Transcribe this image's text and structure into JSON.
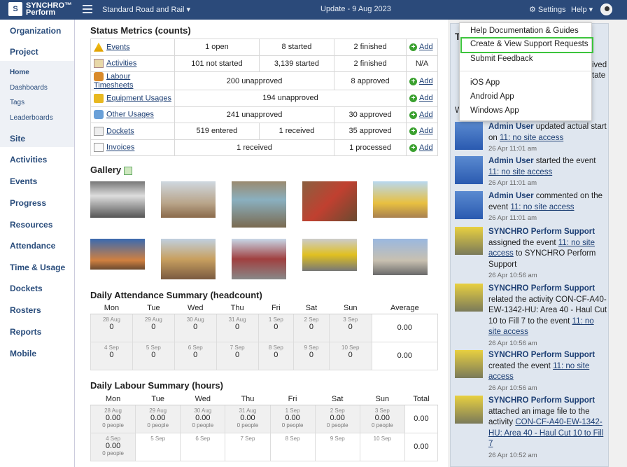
{
  "app": {
    "logo_line1": "SYNCHRO™",
    "logo_line2": "Perform",
    "project": "Standard Road and Rail ▾",
    "update": "Update - 9 Aug 2023",
    "settings": "⚙ Settings",
    "help": "Help ▾"
  },
  "sidebar": {
    "items": [
      "Organization",
      "Project",
      "Site",
      "Activities",
      "Events",
      "Progress",
      "Resources",
      "Attendance",
      "Time & Usage",
      "Dockets",
      "Rosters",
      "Reports",
      "Mobile"
    ],
    "sub": [
      "Home",
      "Dashboards",
      "Tags",
      "Leaderboards"
    ]
  },
  "status": {
    "title": "Status Metrics (counts)",
    "add": "Add",
    "rows": [
      [
        "Events",
        "1 open",
        "8 started",
        "2 finished"
      ],
      [
        "Activities",
        "101 not started",
        "3,139 started",
        "2 finished"
      ],
      [
        "Labour Timesheets",
        "200 unapproved",
        "8 approved"
      ],
      [
        "Equipment Usages",
        "194 unapproved"
      ],
      [
        "Other Usages",
        "241 unapproved",
        "30 approved"
      ],
      [
        "Dockets",
        "519 entered",
        "1 received",
        "35 approved"
      ],
      [
        "Invoices",
        "1 received",
        "1 processed"
      ]
    ],
    "na": "N/A"
  },
  "gallery": {
    "title": "Gallery"
  },
  "attendance": {
    "title": "Daily Attendance Summary (headcount)",
    "days": [
      "Mon",
      "Tue",
      "Wed",
      "Thu",
      "Fri",
      "Sat",
      "Sun",
      "Average"
    ],
    "w1": [
      "28 Aug",
      "29 Aug",
      "30 Aug",
      "31 Aug",
      "1 Sep",
      "2 Sep",
      "3 Sep"
    ],
    "w2": [
      "4 Sep",
      "5 Sep",
      "6 Sep",
      "7 Sep",
      "8 Sep",
      "9 Sep",
      "10 Sep"
    ],
    "val": "0",
    "avg": "0.00"
  },
  "labour": {
    "title": "Daily Labour Summary (hours)",
    "days": [
      "Mon",
      "Tue",
      "Wed",
      "Thu",
      "Fri",
      "Sat",
      "Sun",
      "Total"
    ],
    "val": "0.00",
    "people": "0 people",
    "total": "0.00"
  },
  "help_menu": [
    "Help Documentation & Guides",
    "Create & View Support Requests",
    "Submit Feedback",
    "iOS App",
    "Android App",
    "Windows App"
  ],
  "feed": {
    "behind": [
      "T",
      "ived",
      "tate",
      "W"
    ],
    "items": [
      {
        "who": "Admin User",
        "t1": " updated actual start on ",
        "link": "11: no site access",
        "t2": "",
        "time": "26 Apr 11:01 am"
      },
      {
        "who": "Admin User",
        "t1": " started the event ",
        "link": "11: no site access",
        "t2": "",
        "time": "26 Apr 11:01 am"
      },
      {
        "who": "Admin User",
        "t1": " commented on the event ",
        "link": "11: no site access",
        "t2": "",
        "time": "26 Apr 11:01 am"
      },
      {
        "who": "SYNCHRO Perform Support",
        "t1": " assigned the event ",
        "link": "11: no site access",
        "t2": " to SYNCHRO Perform Support",
        "time": "26 Apr 10:56 am"
      },
      {
        "who": "SYNCHRO Perform Support",
        "t1": " related the activity CON-CF-A40-EW-1342-HU: Area 40 - Haul Cut 10 to Fill 7 to the event ",
        "link": "11: no site access",
        "t2": "",
        "time": "26 Apr 10:56 am"
      },
      {
        "who": "SYNCHRO Perform Support",
        "t1": " created the event ",
        "link": "11: no site access",
        "t2": "",
        "time": "26 Apr 10:56 am"
      },
      {
        "who": "SYNCHRO Perform Support",
        "t1": " attached an image file to the activity ",
        "link": "CON-CF-A40-EW-1342-HU: Area 40 - Haul Cut 10 to Fill 7",
        "t2": "",
        "time": "26 Apr 10:52 am"
      }
    ]
  }
}
